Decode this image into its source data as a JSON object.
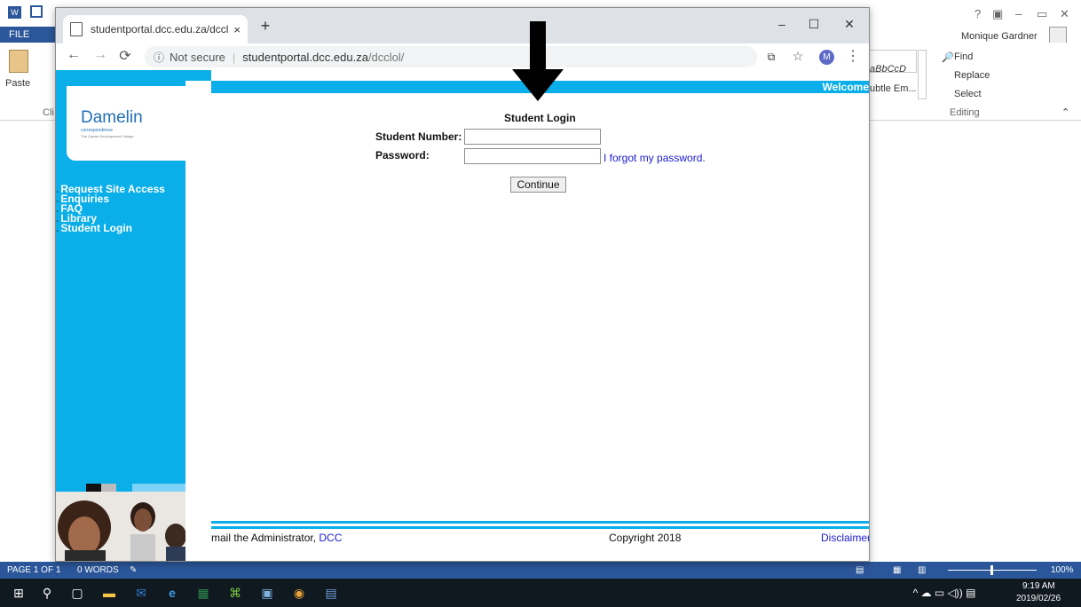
{
  "word": {
    "file_tab": "FILE",
    "user_name": "Monique Gardner",
    "ribbon": {
      "paste_label": "Paste",
      "clipboard_group": "Cli",
      "styles_preview_1": "aBbCcD",
      "styles_preview_2": "ubtle Em...",
      "find_label": "Find",
      "replace_label": "Replace",
      "select_label": "Select",
      "editing_group": "Editing"
    },
    "status": {
      "page": "PAGE 1 OF 1",
      "words": "0 WORDS",
      "zoom": "100%"
    }
  },
  "taskbar": {
    "time": "9:19 AM",
    "date": "2019/02/26"
  },
  "chrome": {
    "tab_title": "studentportal.dcc.edu.za/dcclol/",
    "tab_close": "×",
    "new_tab": "+",
    "address": {
      "security": "Not secure",
      "host": "studentportal.dcc.edu.za",
      "path": "/dcclol/"
    },
    "avatar_letter": "M"
  },
  "portal": {
    "logo": {
      "name": "Damelin",
      "subtitle": "correspondence",
      "tagline": "The Career Development College"
    },
    "welcome": "Welcome",
    "nav": [
      {
        "label": "Request Site Access"
      },
      {
        "label": "Enquiries"
      },
      {
        "label": "FAQ"
      },
      {
        "label": "Library"
      },
      {
        "label": "Student Login"
      }
    ],
    "login": {
      "title": "Student Login",
      "student_number_label": "Student Number:",
      "password_label": "Password:",
      "student_number_value": "",
      "password_value": "",
      "forgot": "I forgot my password.",
      "continue": "Continue"
    },
    "footer": {
      "admin_prefix": "mail the Administrator, ",
      "admin_link": "DCC",
      "copyright": "Copyright 2018",
      "disclaimer": "Disclaimer"
    }
  },
  "colors": {
    "portal_blue": "#0aaee8",
    "link_blue": "#1a1ad6",
    "word_blue": "#2b579a"
  }
}
